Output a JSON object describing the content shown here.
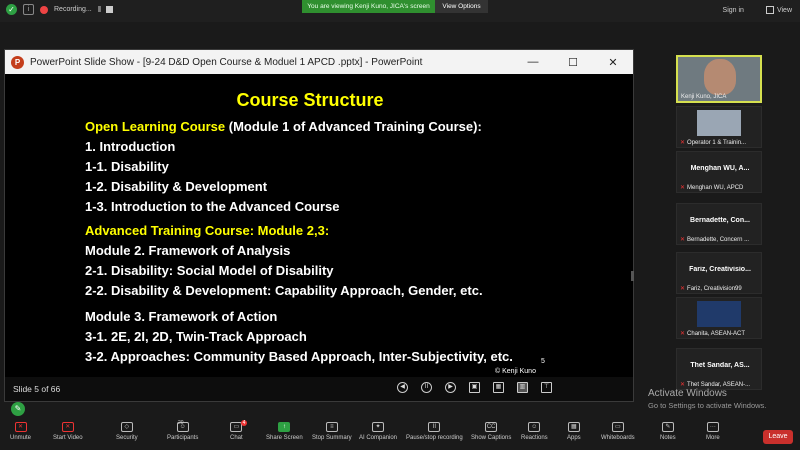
{
  "topbar": {
    "shield_icon": "shield-check-icon",
    "recording_label": "Recording...",
    "pause_glyph": "II",
    "viewing_banner": "You are viewing Kenji Kuno, JICA's screen",
    "view_options": "View Options",
    "sign_in": "Sign in",
    "view": "View"
  },
  "ppt": {
    "logo": "P",
    "title": "PowerPoint Slide Show - [9-24 D&D Open Course & Moduel 1 APCD .pptx] - PowerPoint",
    "slide": {
      "title": "Course Structure",
      "line1_yellow": "Open Learning Course",
      "line1_rest": " (Module 1 of Advanced Training Course):",
      "line2": "1. Introduction",
      "line3": "1-1. Disability",
      "line4": "1-2. Disability & Development",
      "line5": "1-3. Introduction to the Advanced Course",
      "line6": "Advanced Training Course: Module 2,3:",
      "line7": "Module 2. Framework of Analysis",
      "line8": "2-1. Disability: Social Model of Disability",
      "line9": "2-2. Disability & Development: Capability Approach, Gender, etc.",
      "line10": "Module 3. Framework of Action",
      "line11": "3-1. 2E, 2I, 2D, Twin-Track Approach",
      "line12": "3-2. Approaches: Community Based Approach, Inter-Subjectivity, etc.",
      "page_number": "5",
      "credit": "© Kenji Kuno"
    },
    "status": "Slide 5 of 66"
  },
  "participants": [
    {
      "label": "Kenji Kuno, JICA"
    },
    {
      "label": "Operator 1 & Trainin..."
    },
    {
      "name": "Menghan WU, A...",
      "label": "Menghan WU, APCD"
    },
    {
      "name": "Bernadette, Con...",
      "label": "Bernadette, Concern ..."
    },
    {
      "name": "Fariz, Creativisio...",
      "label": "Fariz, Creativision99"
    },
    {
      "label": "Chanita, ASEAN-ACT"
    },
    {
      "name": "Thet Sandar, AS...",
      "label": "Thet Sandar, ASEAN-..."
    }
  ],
  "watermark": {
    "line1": "Activate Windows",
    "line2": "Go to Settings to activate Windows."
  },
  "toolbar": {
    "unmute": "Unmute",
    "start_video": "Start Video",
    "security": "Security",
    "participants": "Participants",
    "participants_count": "20",
    "chat": "Chat",
    "chat_badge": "4",
    "share_screen": "Share Screen",
    "stop_summary": "Stop Summary",
    "ai_companion": "AI Companion",
    "pause_stop_recording": "Pause/stop recording",
    "show_captions": "Show Captions",
    "captions_glyph": "CC",
    "reactions": "Reactions",
    "apps": "Apps",
    "whiteboards": "Whiteboards",
    "notes": "Notes",
    "more": "More",
    "leave": "Leave"
  }
}
